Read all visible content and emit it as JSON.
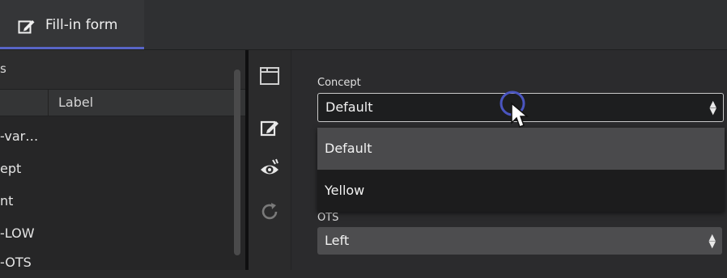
{
  "tab": {
    "label": "Fill-in form",
    "icon": "edit-form-icon",
    "accent": "#5865c7"
  },
  "left_panel": {
    "header_fragment": "s",
    "column_header": "Label",
    "rows": [
      "-var…",
      "ept",
      "nt",
      "-LOW",
      "-OTS"
    ]
  },
  "toolbar": {
    "icons": [
      "window-icon",
      "edit-icon",
      "preview-eye-icon",
      "refresh-icon"
    ]
  },
  "form": {
    "concept": {
      "label": "Concept",
      "value": "Default",
      "options": [
        "Default",
        "Yellow"
      ]
    },
    "ots": {
      "label": "OTS",
      "value": "Left"
    }
  }
}
